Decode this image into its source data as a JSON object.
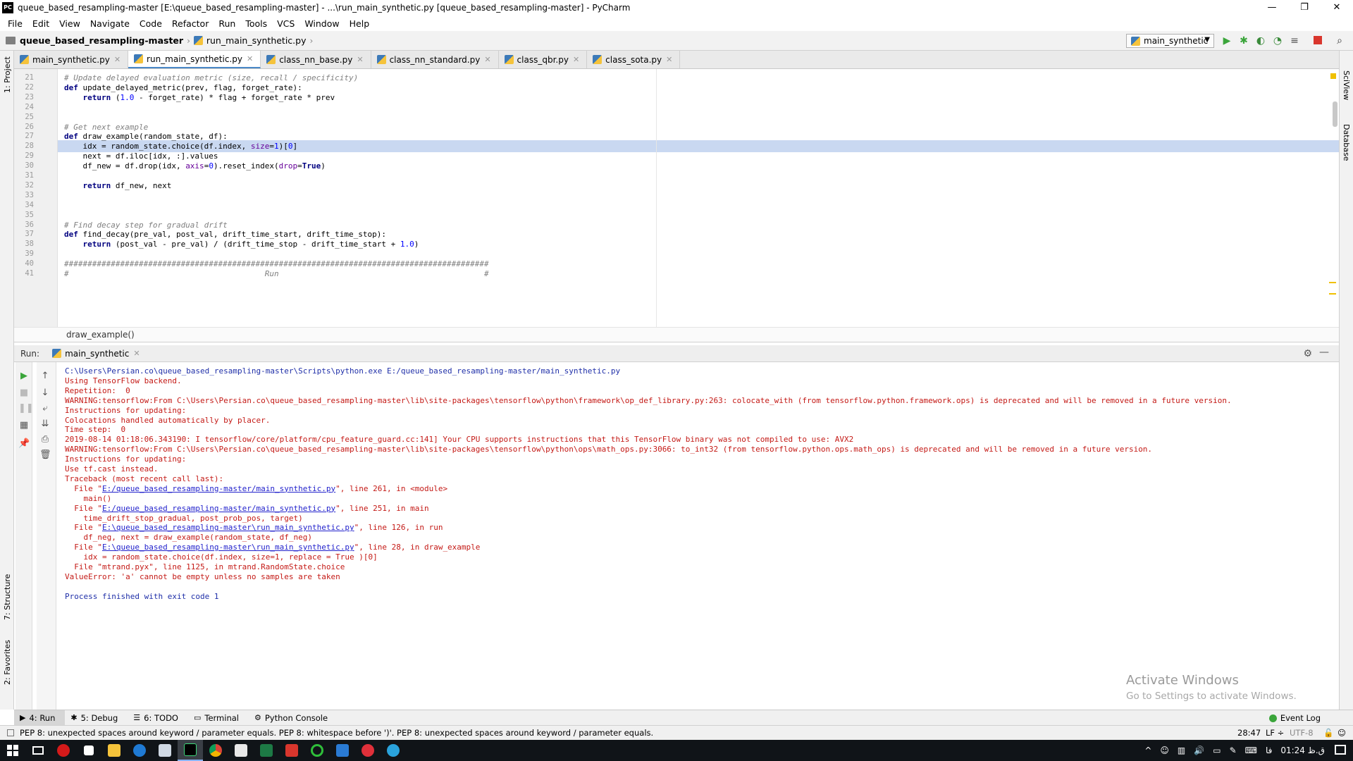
{
  "window": {
    "title": "queue_based_resampling-master [E:\\queue_based_resampling-master] - ...\\run_main_synthetic.py [queue_based_resampling-master] - PyCharm",
    "app_icon_text": "PC"
  },
  "menu": [
    "File",
    "Edit",
    "View",
    "Navigate",
    "Code",
    "Refactor",
    "Run",
    "Tools",
    "VCS",
    "Window",
    "Help"
  ],
  "navbar": {
    "project": "queue_based_resampling-master",
    "file": "run_main_synthetic.py",
    "run_config": "main_synthetic"
  },
  "left_tools": [
    "1: Project",
    "7: Structure",
    "2: Favorites"
  ],
  "right_tools": [
    "SciView",
    "Database"
  ],
  "tabs": [
    {
      "label": "main_synthetic.py",
      "active": false
    },
    {
      "label": "run_main_synthetic.py",
      "active": true
    },
    {
      "label": "class_nn_base.py",
      "active": false
    },
    {
      "label": "class_nn_standard.py",
      "active": false
    },
    {
      "label": "class_qbr.py",
      "active": false
    },
    {
      "label": "class_sota.py",
      "active": false
    }
  ],
  "editor": {
    "lines": [
      {
        "n": "21",
        "html": "<span class='cmt'># Update delayed evaluation metric (size, recall / specificity)</span>"
      },
      {
        "n": "22",
        "html": "<span class='kw'>def</span> update_delayed_metric(prev, flag, forget_rate):"
      },
      {
        "n": "23",
        "html": "    <span class='kw'>return</span> (<span class='num'>1.0</span> - forget_rate) * flag + forget_rate * prev"
      },
      {
        "n": "24",
        "html": ""
      },
      {
        "n": "25",
        "html": ""
      },
      {
        "n": "26",
        "html": "<span class='cmt'># Get next example</span>"
      },
      {
        "n": "27",
        "html": "<span class='kw'>def</span> draw_example(random_state, df):"
      },
      {
        "n": "28",
        "html": "    idx = random_state.choice(df.index, <span class='kwarg'>size</span>=<span class='num'>1</span>)[<span class='num'>0</span>]"
      },
      {
        "n": "29",
        "html": "    next = df.iloc[idx, :].values"
      },
      {
        "n": "30",
        "html": "    df_new = df.drop(idx, <span class='kwarg'>axis</span>=<span class='num'>0</span>).reset_index(<span class='kwarg'>drop</span>=<span class='kw'>True</span>)"
      },
      {
        "n": "31",
        "html": ""
      },
      {
        "n": "32",
        "html": "    <span class='kw'>return</span> df_new, next"
      },
      {
        "n": "33",
        "html": ""
      },
      {
        "n": "34",
        "html": ""
      },
      {
        "n": "35",
        "html": ""
      },
      {
        "n": "36",
        "html": "<span class='cmt'># Find decay step for gradual drift</span>"
      },
      {
        "n": "37",
        "html": "<span class='kw'>def</span> find_decay(pre_val, post_val, drift_time_start, drift_time_stop):"
      },
      {
        "n": "38",
        "html": "    <span class='kw'>return</span> (post_val - pre_val) / (drift_time_stop - drift_time_start + <span class='num'>1.0</span>)"
      },
      {
        "n": "39",
        "html": ""
      },
      {
        "n": "40",
        "html": "<span class='cmt'>###########################################################################################</span>"
      },
      {
        "n": "41",
        "html": "<span class='cmt'>#                                          Run                                            #</span>"
      }
    ],
    "current_line": "28"
  },
  "breadcrumb_bottom": "draw_example()",
  "run": {
    "label": "Run:",
    "tab": "main_synthetic",
    "console": [
      {
        "cls": "blue",
        "html": "C:\\Users\\Persian.co\\queue_based_resampling-master\\Scripts\\python.exe E:/queue_based_resampling-master/main_synthetic.py"
      },
      {
        "cls": "",
        "html": "Using TensorFlow backend."
      },
      {
        "cls": "",
        "html": "Repetition:  0"
      },
      {
        "cls": "",
        "html": "WARNING:tensorflow:From C:\\Users\\Persian.co\\queue_based_resampling-master\\lib\\site-packages\\tensorflow\\python\\framework\\op_def_library.py:263: colocate_with (from tensorflow.python.framework.ops) is deprecated and will be removed in a future version."
      },
      {
        "cls": "",
        "html": "Instructions for updating:"
      },
      {
        "cls": "",
        "html": "Colocations handled automatically by placer."
      },
      {
        "cls": "",
        "html": "Time step:  0"
      },
      {
        "cls": "",
        "html": "2019-08-14 01:18:06.343190: I tensorflow/core/platform/cpu_feature_guard.cc:141] Your CPU supports instructions that this TensorFlow binary was not compiled to use: AVX2"
      },
      {
        "cls": "",
        "html": "WARNING:tensorflow:From C:\\Users\\Persian.co\\queue_based_resampling-master\\lib\\site-packages\\tensorflow\\python\\ops\\math_ops.py:3066: to_int32 (from tensorflow.python.ops.math_ops) is deprecated and will be removed in a future version."
      },
      {
        "cls": "",
        "html": "Instructions for updating:"
      },
      {
        "cls": "",
        "html": "Use tf.cast instead."
      },
      {
        "cls": "",
        "html": "Traceback (most recent call last):"
      },
      {
        "cls": "",
        "html": "  File \"<a>E:/queue_based_resampling-master/main_synthetic.py</a>\", line 261, in &lt;module&gt;"
      },
      {
        "cls": "",
        "html": "    main()"
      },
      {
        "cls": "",
        "html": "  File \"<a>E:/queue_based_resampling-master/main_synthetic.py</a>\", line 251, in main"
      },
      {
        "cls": "",
        "html": "    time_drift_stop_gradual, post_prob_pos, target)"
      },
      {
        "cls": "",
        "html": "  File \"<a>E:\\queue_based_resampling-master\\run_main_synthetic.py</a>\", line 126, in run"
      },
      {
        "cls": "",
        "html": "    df_neg, next = draw_example(random_state, df_neg)"
      },
      {
        "cls": "",
        "html": "  File \"<a>E:\\queue_based_resampling-master\\run_main_synthetic.py</a>\", line 28, in draw_example"
      },
      {
        "cls": "",
        "html": "    idx = random_state.choice(df.index, size=1, replace = True )[0]"
      },
      {
        "cls": "",
        "html": "  File \"mtrand.pyx\", line 1125, in mtrand.RandomState.choice"
      },
      {
        "cls": "",
        "html": "ValueError: 'a' cannot be empty unless no samples are taken"
      },
      {
        "cls": "",
        "html": ""
      },
      {
        "cls": "blue",
        "html": "Process finished with exit code 1"
      }
    ]
  },
  "activation": {
    "title": "Activate Windows",
    "subtitle": "Go to Settings to activate Windows."
  },
  "tool_tabs": [
    {
      "label": "4: Run",
      "icon": "▶",
      "active": true
    },
    {
      "label": "5: Debug",
      "icon": "✱",
      "active": false
    },
    {
      "label": "6: TODO",
      "icon": "☰",
      "active": false
    },
    {
      "label": "Terminal",
      "icon": "▭",
      "active": false
    },
    {
      "label": "Python Console",
      "icon": "⚙",
      "active": false
    }
  ],
  "event_log": "Event Log",
  "status": {
    "message": "PEP 8: unexpected spaces around keyword / parameter equals. PEP 8: whitespace before ')'. PEP 8: unexpected spaces around keyword / parameter equals.",
    "position": "28:47",
    "line_sep": "LF ÷",
    "encoding": "UTF-8"
  },
  "taskbar": {
    "lang": "فا",
    "clock": "01:24 ق.ظ"
  }
}
